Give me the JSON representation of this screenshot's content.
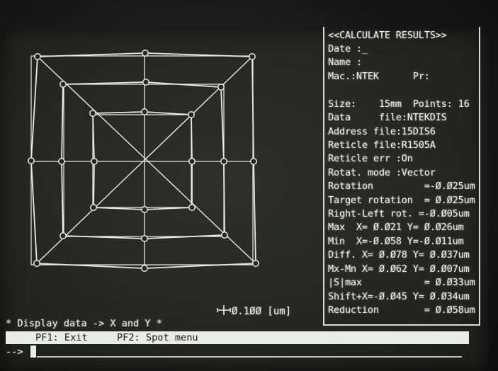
{
  "panel": {
    "header": "<<CALCULATE RESULTS>>",
    "lines": [
      "Date :_",
      "Name :",
      "Mac.:NTEK      Pr:",
      "",
      "Size:    15mm  Points: 16",
      "Data     file:NTEKDIS",
      "Address file:15DIS6",
      "Reticle file:R1505A",
      "Reticle err :On",
      "Rotat. mode :Vector",
      "Rotation         =-Ø.Ø25um",
      "Target rotation  = Ø.Ø25um",
      "Right-Left rot. =-Ø.Ø05um",
      "Max  X= Ø.Ø21 Y= Ø.Ø26um",
      "Min  X=-Ø.Ø58 Y=-Ø.Ø11um",
      "Diff. X= Ø.Ø78 Y= Ø.Ø37um",
      "Mx-Mn X= Ø.Ø62 Y= Ø.Ø07um",
      "|S|max           = Ø.Ø33um",
      "Shift+X=-Ø.Ø45 Y= Ø.Ø34um",
      "Reduction        = Ø.Ø58um"
    ]
  },
  "scale": {
    "label": "Ø.1ØØ [um]",
    "icon": "crosshair-icon"
  },
  "display_line": "* Display data -> X and Y *",
  "menu": {
    "pf1": "PF1: Exit",
    "pf2": "PF2: Spot menu"
  },
  "prompt": "-->",
  "colors": {
    "phosphor": "#eef0ea",
    "screen": "#262725"
  }
}
